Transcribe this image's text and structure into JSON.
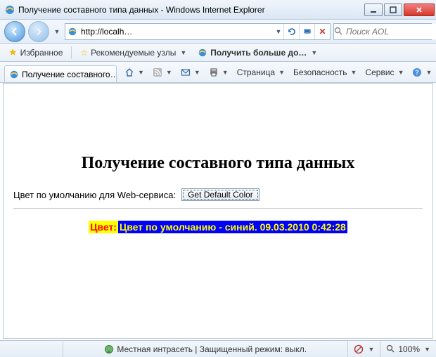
{
  "window": {
    "title": "Получение составного типа данных - Windows Internet Explorer"
  },
  "nav": {
    "url": "http://localh…",
    "search_placeholder": "Поиск AOL"
  },
  "favbar": {
    "favorites": "Избранное",
    "recommended": "Рекомендуемые узлы",
    "get_more": "Получить больше до…"
  },
  "tab": {
    "title": "Получение составного…"
  },
  "cmd": {
    "page": "Страница",
    "security": "Безопасность",
    "service": "Сервис"
  },
  "page": {
    "heading": "Получение составного типа данных",
    "default_label": "Цвет по умолчанию для Web-сервиса:",
    "button": "Get Default Color",
    "result_key": "Цвет:",
    "result_val": "Цвет по умолчанию - синий. 09.03.2010 0:42:28"
  },
  "status": {
    "zone": "Местная интрасеть | Защищенный режим: выкл.",
    "zoom": "100%"
  }
}
